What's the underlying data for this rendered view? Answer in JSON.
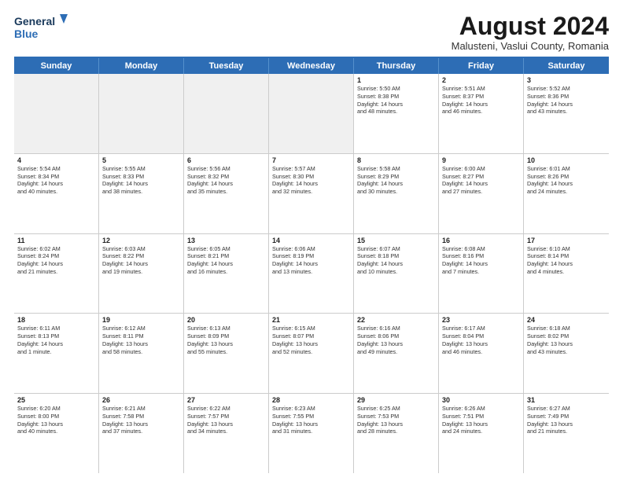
{
  "logo": {
    "line1": "General",
    "line2": "Blue"
  },
  "title": "August 2024",
  "subtitle": "Malusteni, Vaslui County, Romania",
  "weekdays": [
    "Sunday",
    "Monday",
    "Tuesday",
    "Wednesday",
    "Thursday",
    "Friday",
    "Saturday"
  ],
  "rows": [
    [
      {
        "day": "",
        "info": "",
        "shaded": true
      },
      {
        "day": "",
        "info": "",
        "shaded": true
      },
      {
        "day": "",
        "info": "",
        "shaded": true
      },
      {
        "day": "",
        "info": "",
        "shaded": true
      },
      {
        "day": "1",
        "info": "Sunrise: 5:50 AM\nSunset: 8:38 PM\nDaylight: 14 hours\nand 48 minutes."
      },
      {
        "day": "2",
        "info": "Sunrise: 5:51 AM\nSunset: 8:37 PM\nDaylight: 14 hours\nand 46 minutes."
      },
      {
        "day": "3",
        "info": "Sunrise: 5:52 AM\nSunset: 8:36 PM\nDaylight: 14 hours\nand 43 minutes."
      }
    ],
    [
      {
        "day": "4",
        "info": "Sunrise: 5:54 AM\nSunset: 8:34 PM\nDaylight: 14 hours\nand 40 minutes."
      },
      {
        "day": "5",
        "info": "Sunrise: 5:55 AM\nSunset: 8:33 PM\nDaylight: 14 hours\nand 38 minutes."
      },
      {
        "day": "6",
        "info": "Sunrise: 5:56 AM\nSunset: 8:32 PM\nDaylight: 14 hours\nand 35 minutes."
      },
      {
        "day": "7",
        "info": "Sunrise: 5:57 AM\nSunset: 8:30 PM\nDaylight: 14 hours\nand 32 minutes."
      },
      {
        "day": "8",
        "info": "Sunrise: 5:58 AM\nSunset: 8:29 PM\nDaylight: 14 hours\nand 30 minutes."
      },
      {
        "day": "9",
        "info": "Sunrise: 6:00 AM\nSunset: 8:27 PM\nDaylight: 14 hours\nand 27 minutes."
      },
      {
        "day": "10",
        "info": "Sunrise: 6:01 AM\nSunset: 8:26 PM\nDaylight: 14 hours\nand 24 minutes."
      }
    ],
    [
      {
        "day": "11",
        "info": "Sunrise: 6:02 AM\nSunset: 8:24 PM\nDaylight: 14 hours\nand 21 minutes."
      },
      {
        "day": "12",
        "info": "Sunrise: 6:03 AM\nSunset: 8:22 PM\nDaylight: 14 hours\nand 19 minutes."
      },
      {
        "day": "13",
        "info": "Sunrise: 6:05 AM\nSunset: 8:21 PM\nDaylight: 14 hours\nand 16 minutes."
      },
      {
        "day": "14",
        "info": "Sunrise: 6:06 AM\nSunset: 8:19 PM\nDaylight: 14 hours\nand 13 minutes."
      },
      {
        "day": "15",
        "info": "Sunrise: 6:07 AM\nSunset: 8:18 PM\nDaylight: 14 hours\nand 10 minutes."
      },
      {
        "day": "16",
        "info": "Sunrise: 6:08 AM\nSunset: 8:16 PM\nDaylight: 14 hours\nand 7 minutes."
      },
      {
        "day": "17",
        "info": "Sunrise: 6:10 AM\nSunset: 8:14 PM\nDaylight: 14 hours\nand 4 minutes."
      }
    ],
    [
      {
        "day": "18",
        "info": "Sunrise: 6:11 AM\nSunset: 8:13 PM\nDaylight: 14 hours\nand 1 minute."
      },
      {
        "day": "19",
        "info": "Sunrise: 6:12 AM\nSunset: 8:11 PM\nDaylight: 13 hours\nand 58 minutes."
      },
      {
        "day": "20",
        "info": "Sunrise: 6:13 AM\nSunset: 8:09 PM\nDaylight: 13 hours\nand 55 minutes."
      },
      {
        "day": "21",
        "info": "Sunrise: 6:15 AM\nSunset: 8:07 PM\nDaylight: 13 hours\nand 52 minutes."
      },
      {
        "day": "22",
        "info": "Sunrise: 6:16 AM\nSunset: 8:06 PM\nDaylight: 13 hours\nand 49 minutes."
      },
      {
        "day": "23",
        "info": "Sunrise: 6:17 AM\nSunset: 8:04 PM\nDaylight: 13 hours\nand 46 minutes."
      },
      {
        "day": "24",
        "info": "Sunrise: 6:18 AM\nSunset: 8:02 PM\nDaylight: 13 hours\nand 43 minutes."
      }
    ],
    [
      {
        "day": "25",
        "info": "Sunrise: 6:20 AM\nSunset: 8:00 PM\nDaylight: 13 hours\nand 40 minutes."
      },
      {
        "day": "26",
        "info": "Sunrise: 6:21 AM\nSunset: 7:58 PM\nDaylight: 13 hours\nand 37 minutes."
      },
      {
        "day": "27",
        "info": "Sunrise: 6:22 AM\nSunset: 7:57 PM\nDaylight: 13 hours\nand 34 minutes."
      },
      {
        "day": "28",
        "info": "Sunrise: 6:23 AM\nSunset: 7:55 PM\nDaylight: 13 hours\nand 31 minutes."
      },
      {
        "day": "29",
        "info": "Sunrise: 6:25 AM\nSunset: 7:53 PM\nDaylight: 13 hours\nand 28 minutes."
      },
      {
        "day": "30",
        "info": "Sunrise: 6:26 AM\nSunset: 7:51 PM\nDaylight: 13 hours\nand 24 minutes."
      },
      {
        "day": "31",
        "info": "Sunrise: 6:27 AM\nSunset: 7:49 PM\nDaylight: 13 hours\nand 21 minutes."
      }
    ]
  ]
}
